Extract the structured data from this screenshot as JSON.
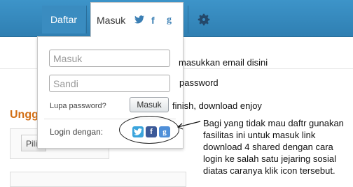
{
  "nav": {
    "daftar_label": "Daftar",
    "masuk_label": "Masuk",
    "masuk_icons": [
      "twitter-icon",
      "facebook-icon",
      "google-icon"
    ],
    "settings_icon": "gear-icon"
  },
  "login_form": {
    "email_placeholder": "Masuk",
    "password_placeholder": "Sandi",
    "forgot_password": "Lupa password?",
    "submit_label": "Masuk",
    "login_with_label": "Login dengan:",
    "social_buttons": [
      "twitter-icon",
      "facebook-icon",
      "google-icon"
    ]
  },
  "background": {
    "heading_partial": "Unggi",
    "button_partial": "Pili"
  },
  "annotations": {
    "email_note": "masukkan email disini",
    "password_note": "password",
    "finish_note": "finish, download enjoy",
    "social_note_lines": [
      "Bagi yang tidak mau daftr gunakan",
      "fasilitas ini untuk masuk link",
      "download 4 shared dengan cara",
      "login ke salah satu jejaring sosial",
      "diatas caranya klik icon tersebut."
    ]
  },
  "colors": {
    "topbar": "#3a8cc0",
    "heading_orange": "#d26e14",
    "social_twitter": "#3aa4dc",
    "social_facebook": "#3b5998",
    "social_google": "#4f8fd8"
  }
}
